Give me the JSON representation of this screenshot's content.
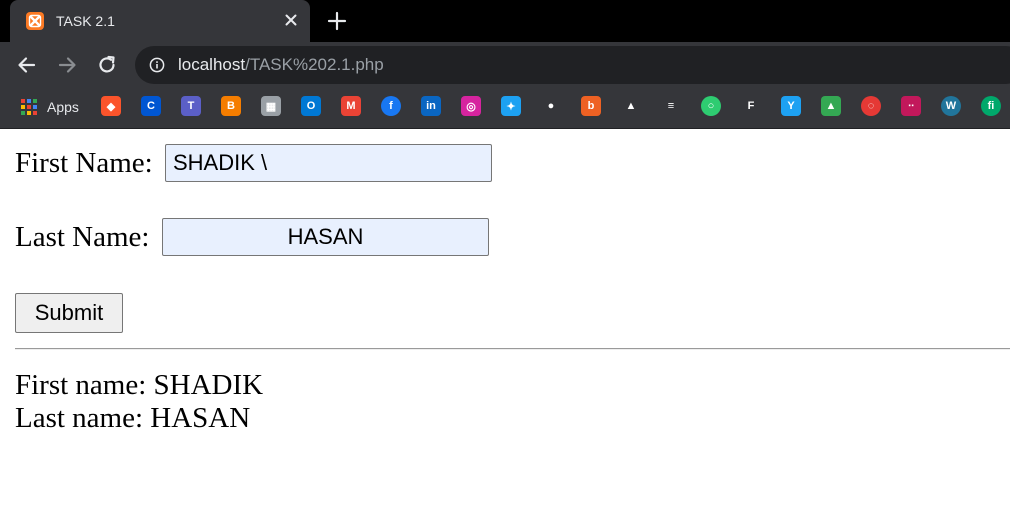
{
  "tab": {
    "title": "TASK 2.1"
  },
  "address_bar": {
    "host": "localhost",
    "path": "/TASK%202.1.php"
  },
  "bookmarks": {
    "apps_label": "Apps",
    "items": [
      {
        "name": "brave",
        "color": "#fb542b"
      },
      {
        "name": "coursera",
        "color": "#0056d2"
      },
      {
        "name": "teams",
        "color": "#5b5fc7"
      },
      {
        "name": "blogger",
        "color": "#f57d00"
      },
      {
        "name": "image",
        "color": "#9aa0a6"
      },
      {
        "name": "outlook",
        "color": "#0078d4"
      },
      {
        "name": "gmail",
        "color": "#ea4335"
      },
      {
        "name": "facebook",
        "color": "#1877f2"
      },
      {
        "name": "linkedin",
        "color": "#0a66c2"
      },
      {
        "name": "instagram",
        "color": "#d6249f"
      },
      {
        "name": "twitter",
        "color": "#1da1f2"
      },
      {
        "name": "github",
        "color": "#ffffff"
      },
      {
        "name": "bitly",
        "color": "#ee6123"
      },
      {
        "name": "shapes",
        "color": "#ffffff"
      },
      {
        "name": "tasks",
        "color": "#ffffff"
      },
      {
        "name": "circle",
        "color": "#2ecc71"
      },
      {
        "name": "flag",
        "color": "#ffffff"
      },
      {
        "name": "tab-y",
        "color": "#1da1f2"
      },
      {
        "name": "drive",
        "color": "#34a853"
      },
      {
        "name": "spinner",
        "color": "#e53935"
      },
      {
        "name": "dots",
        "color": "#c2185b"
      },
      {
        "name": "wordpress",
        "color": "#21759b"
      },
      {
        "name": "fi",
        "color": "#00a86b"
      }
    ]
  },
  "form": {
    "first_name_label": "First Name:",
    "first_name_value": "SHADIK  \\",
    "last_name_label": "Last Name:",
    "last_name_value": "HASAN",
    "submit_label": "Submit"
  },
  "output": {
    "first_line": "First name: SHADIK",
    "last_line": "Last name: HASAN"
  }
}
